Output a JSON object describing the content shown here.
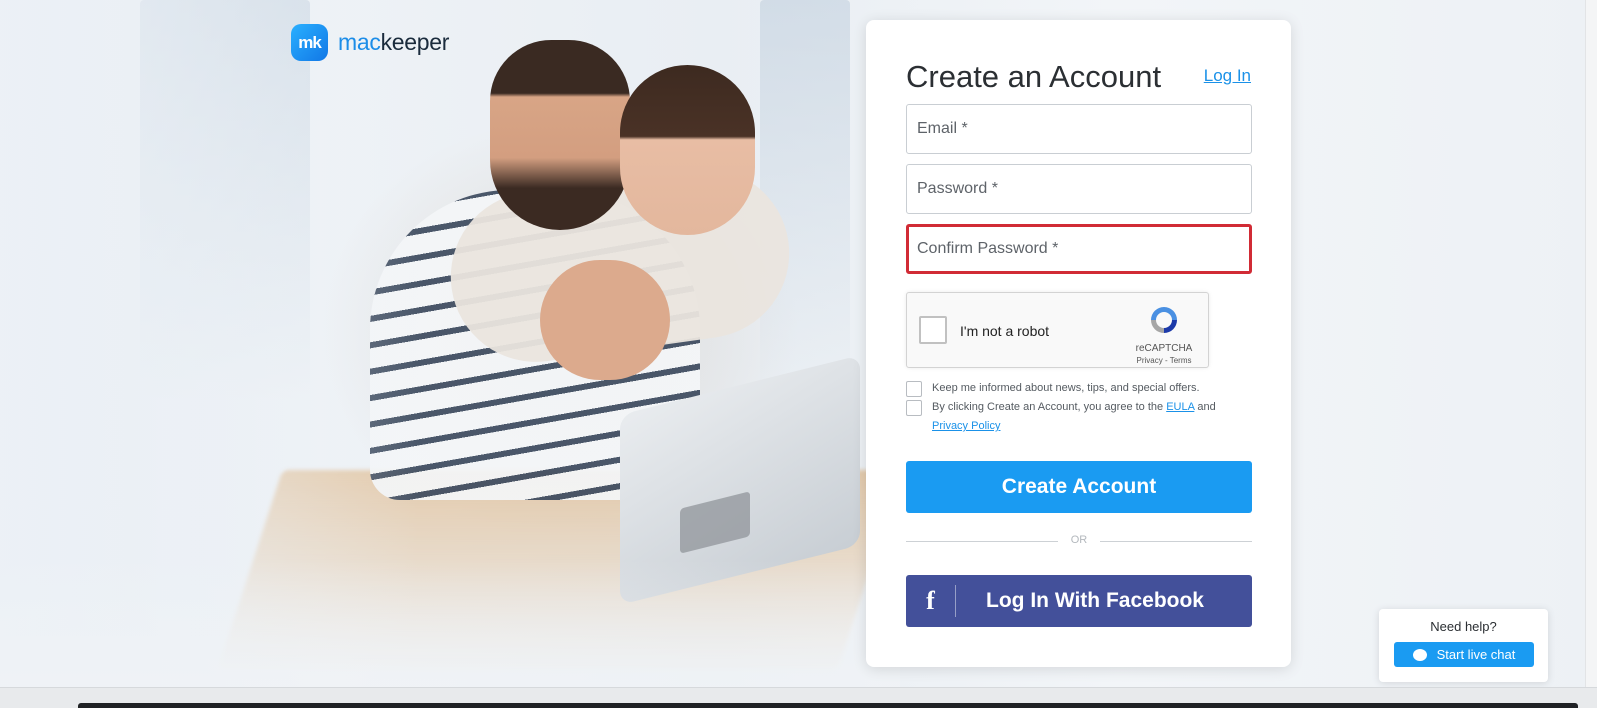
{
  "brand": {
    "logo_mark": "mk",
    "name_part1": "mac",
    "name_part2": "keeper"
  },
  "form": {
    "title": "Create an Account",
    "login_link": "Log In",
    "email_placeholder": "Email *",
    "password_placeholder": "Password *",
    "confirm_placeholder": "Confirm Password *",
    "confirm_error_color": "#d12b35",
    "captcha": {
      "label": "I'm not a robot",
      "brand": "reCAPTCHA",
      "privacy": "Privacy",
      "sep": " - ",
      "terms": "Terms"
    },
    "newsletter_label": "Keep me informed about news, tips, and special offers.",
    "agree_prefix": "By clicking Create an Account, you agree to the ",
    "eula_link": "EULA",
    "agree_and": " and",
    "privacy_link": "Privacy Policy",
    "create_button": "Create Account",
    "divider_text": "OR",
    "facebook_icon": "f",
    "facebook_button": "Log In With Facebook"
  },
  "help": {
    "title": "Need help?",
    "chat_button": "Start live chat"
  },
  "colors": {
    "primary": "#1a9bf2",
    "facebook": "#43509a",
    "link": "#1a91e8"
  }
}
